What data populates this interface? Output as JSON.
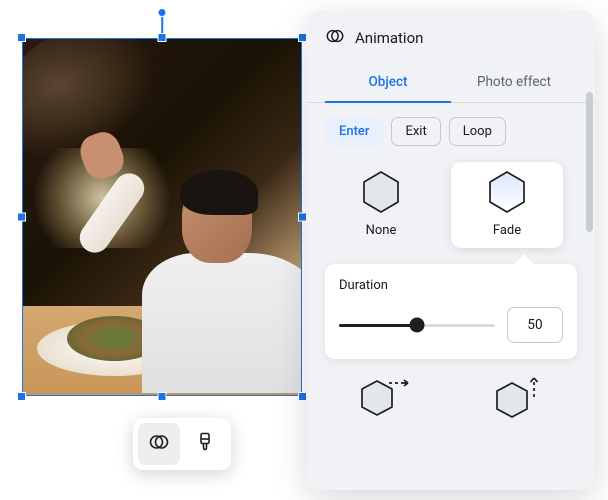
{
  "panel": {
    "title": "Animation",
    "tabs": {
      "object": "Object",
      "photo_effect": "Photo effect"
    },
    "chips": {
      "enter": "Enter",
      "exit": "Exit",
      "loop": "Loop"
    },
    "options": {
      "none": "None",
      "fade": "Fade"
    },
    "duration": {
      "label": "Duration",
      "value": "50"
    }
  },
  "colors": {
    "accent": "#1a73e8"
  }
}
